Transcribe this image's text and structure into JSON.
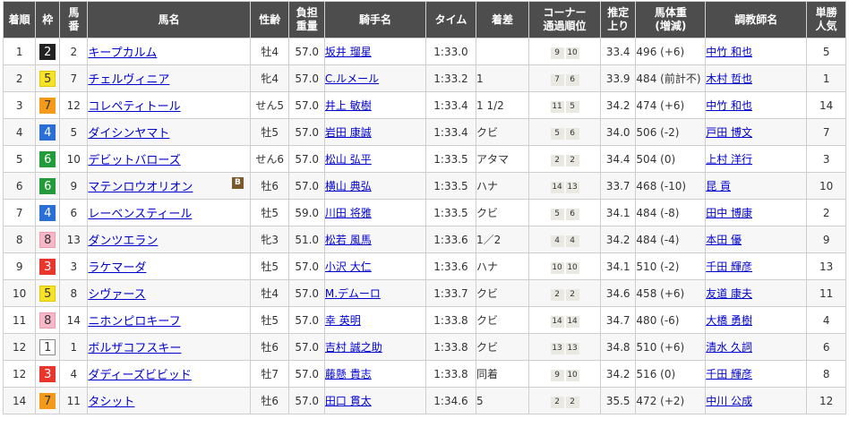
{
  "header": {
    "rank": "着順",
    "waku": "枠",
    "umaban": [
      "馬",
      "番"
    ],
    "horse": "馬名",
    "sex_age": "性齢",
    "weight": [
      "負担",
      "重量"
    ],
    "jockey": "騎手名",
    "time": "タイム",
    "margin": "着差",
    "corner": [
      "コーナー",
      "通過順位"
    ],
    "last3f": [
      "推定",
      "上り"
    ],
    "body_weight": [
      "馬体重",
      "(増減)"
    ],
    "trainer": "調教師名",
    "odds": [
      "単勝",
      "人気"
    ]
  },
  "waku_colors": {
    "1": {
      "bg": "#ffffff",
      "fg": "#333333",
      "border": "#888888"
    },
    "2": {
      "bg": "#222222",
      "fg": "#ffffff",
      "border": "#222222"
    },
    "3": {
      "bg": "#e8362c",
      "fg": "#ffffff",
      "border": "#e8362c"
    },
    "4": {
      "bg": "#2a6fd6",
      "fg": "#ffffff",
      "border": "#2a6fd6"
    },
    "5": {
      "bg": "#f7e22a",
      "fg": "#333333",
      "border": "#e0c800"
    },
    "6": {
      "bg": "#249b3a",
      "fg": "#ffffff",
      "border": "#249b3a"
    },
    "7": {
      "bg": "#f39a1b",
      "fg": "#333333",
      "border": "#f39a1b"
    },
    "8": {
      "bg": "#f6b8c8",
      "fg": "#333333",
      "border": "#f09ab0"
    }
  },
  "rows": [
    {
      "rank": "1",
      "waku": "2",
      "umaban": "2",
      "horse": "キープカルム",
      "blinker": "",
      "sex_age": "牡4",
      "weight": "57.0",
      "jockey": "坂井 瑠星",
      "time": "1:33.0",
      "margin": "",
      "corners": [
        "9",
        "10"
      ],
      "last3f": "33.4",
      "body_weight": "496 (+6)",
      "trainer": "中竹 和也",
      "odds": "5"
    },
    {
      "rank": "2",
      "waku": "5",
      "umaban": "7",
      "horse": "チェルヴィニア",
      "blinker": "",
      "sex_age": "牝4",
      "weight": "57.0",
      "jockey": "C.ルメール",
      "time": "1:33.2",
      "margin": "1",
      "corners": [
        "7",
        "6"
      ],
      "last3f": "33.9",
      "body_weight": "484 (前計不)",
      "trainer": "木村 哲也",
      "odds": "1"
    },
    {
      "rank": "3",
      "waku": "7",
      "umaban": "12",
      "horse": "コレペティトール",
      "blinker": "",
      "sex_age": "せん5",
      "weight": "57.0",
      "jockey": "井上 敏樹",
      "time": "1:33.4",
      "margin": "1 1/2",
      "corners": [
        "11",
        "5"
      ],
      "last3f": "34.2",
      "body_weight": "474 (+6)",
      "trainer": "中竹 和也",
      "odds": "14"
    },
    {
      "rank": "4",
      "waku": "4",
      "umaban": "5",
      "horse": "ダイシンヤマト",
      "blinker": "",
      "sex_age": "牡5",
      "weight": "57.0",
      "jockey": "岩田 康誠",
      "time": "1:33.4",
      "margin": "クビ",
      "corners": [
        "5",
        "6"
      ],
      "last3f": "34.0",
      "body_weight": "506 (-2)",
      "trainer": "戸田 博文",
      "odds": "7"
    },
    {
      "rank": "5",
      "waku": "6",
      "umaban": "10",
      "horse": "デビットバローズ",
      "blinker": "",
      "sex_age": "せん6",
      "weight": "57.0",
      "jockey": "松山 弘平",
      "time": "1:33.5",
      "margin": "アタマ",
      "corners": [
        "2",
        "2"
      ],
      "last3f": "34.4",
      "body_weight": "504 (0)",
      "trainer": "上村 洋行",
      "odds": "3"
    },
    {
      "rank": "6",
      "waku": "6",
      "umaban": "9",
      "horse": "マテンロウオリオン",
      "blinker": "B",
      "sex_age": "牡6",
      "weight": "57.0",
      "jockey": "横山 典弘",
      "time": "1:33.5",
      "margin": "ハナ",
      "corners": [
        "14",
        "13"
      ],
      "last3f": "33.7",
      "body_weight": "468 (-10)",
      "trainer": "昆 貢",
      "odds": "10"
    },
    {
      "rank": "7",
      "waku": "4",
      "umaban": "6",
      "horse": "レーベンスティール",
      "blinker": "",
      "sex_age": "牡5",
      "weight": "59.0",
      "jockey": "川田 将雅",
      "time": "1:33.5",
      "margin": "クビ",
      "corners": [
        "5",
        "6"
      ],
      "last3f": "34.1",
      "body_weight": "484 (-8)",
      "trainer": "田中 博康",
      "odds": "2"
    },
    {
      "rank": "8",
      "waku": "8",
      "umaban": "13",
      "horse": "ダンツエラン",
      "blinker": "",
      "sex_age": "牝3",
      "weight": "51.0",
      "jockey": "松若 風馬",
      "time": "1:33.6",
      "margin": "1／2",
      "corners": [
        "4",
        "4"
      ],
      "last3f": "34.2",
      "body_weight": "484 (-4)",
      "trainer": "本田 優",
      "odds": "9"
    },
    {
      "rank": "9",
      "waku": "3",
      "umaban": "3",
      "horse": "ラケマーダ",
      "blinker": "",
      "sex_age": "牡5",
      "weight": "57.0",
      "jockey": "小沢 大仁",
      "time": "1:33.6",
      "margin": "ハナ",
      "corners": [
        "10",
        "10"
      ],
      "last3f": "34.1",
      "body_weight": "510 (-2)",
      "trainer": "千田 輝彦",
      "odds": "13"
    },
    {
      "rank": "10",
      "waku": "5",
      "umaban": "8",
      "horse": "シヴァース",
      "blinker": "",
      "sex_age": "牡4",
      "weight": "57.0",
      "jockey": "M.デムーロ",
      "time": "1:33.7",
      "margin": "クビ",
      "corners": [
        "2",
        "2"
      ],
      "last3f": "34.6",
      "body_weight": "458 (+6)",
      "trainer": "友道 康夫",
      "odds": "11"
    },
    {
      "rank": "11",
      "waku": "8",
      "umaban": "14",
      "horse": "ニホンピロキーフ",
      "blinker": "",
      "sex_age": "牡5",
      "weight": "57.0",
      "jockey": "幸 英明",
      "time": "1:33.8",
      "margin": "クビ",
      "corners": [
        "14",
        "14"
      ],
      "last3f": "34.7",
      "body_weight": "480 (-6)",
      "trainer": "大橋 勇樹",
      "odds": "4"
    },
    {
      "rank": "12",
      "waku": "1",
      "umaban": "1",
      "horse": "ボルザコフスキー",
      "blinker": "",
      "sex_age": "牡6",
      "weight": "57.0",
      "jockey": "吉村 誠之助",
      "time": "1:33.8",
      "margin": "クビ",
      "corners": [
        "13",
        "13"
      ],
      "last3f": "34.8",
      "body_weight": "510 (+6)",
      "trainer": "清水 久詞",
      "odds": "6"
    },
    {
      "rank": "12",
      "waku": "3",
      "umaban": "4",
      "horse": "ダディーズビビッド",
      "blinker": "",
      "sex_age": "牡7",
      "weight": "57.0",
      "jockey": "藤懸 貴志",
      "time": "1:33.8",
      "margin": "同着",
      "corners": [
        "9",
        "10"
      ],
      "last3f": "34.2",
      "body_weight": "516 (0)",
      "trainer": "千田 輝彦",
      "odds": "8"
    },
    {
      "rank": "14",
      "waku": "7",
      "umaban": "11",
      "horse": "タシット",
      "blinker": "",
      "sex_age": "牡6",
      "weight": "57.0",
      "jockey": "田口 貫太",
      "time": "1:34.6",
      "margin": "5",
      "corners": [
        "2",
        "2"
      ],
      "last3f": "35.5",
      "body_weight": "472 (+2)",
      "trainer": "中川 公成",
      "odds": "12"
    }
  ]
}
